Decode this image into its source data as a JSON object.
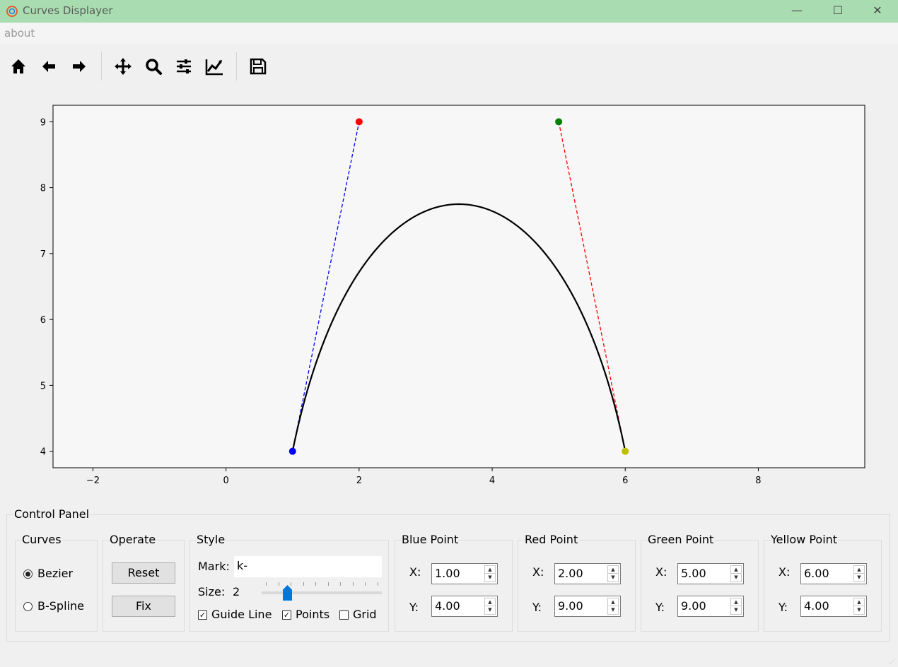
{
  "window": {
    "title": "Curves Displayer"
  },
  "menu": {
    "about": "about"
  },
  "toolbar": {
    "icons": [
      "home-icon",
      "back-arrow-icon",
      "forward-arrow-icon",
      "pan-icon",
      "zoom-icon",
      "configure-subplots-icon",
      "edit-axis-icon",
      "save-icon"
    ]
  },
  "chart_data": {
    "type": "line",
    "title": "",
    "xlabel": "",
    "ylabel": "",
    "xlim": [
      -2.6,
      9.6
    ],
    "ylim": [
      3.75,
      9.25
    ],
    "x_ticks": [
      "−2",
      "0",
      "2",
      "4",
      "6",
      "8"
    ],
    "y_ticks": [
      "4",
      "5",
      "6",
      "7",
      "8",
      "9"
    ],
    "grid": false,
    "control_points": [
      {
        "color": "#0000ff",
        "x": 1,
        "y": 4
      },
      {
        "color": "#ff0000",
        "x": 2,
        "y": 9
      },
      {
        "color": "#008000",
        "x": 5,
        "y": 9
      },
      {
        "color": "#bfbf00",
        "x": 6,
        "y": 4
      }
    ],
    "guide_lines": [
      {
        "color": "#0000ff",
        "from": [
          1,
          4
        ],
        "to": [
          2,
          9
        ]
      },
      {
        "color": "#ff0000",
        "from": [
          5,
          9
        ],
        "to": [
          6,
          4
        ]
      }
    ],
    "curve": {
      "kind": "cubic-bezier",
      "color": "#000000"
    }
  },
  "panel": {
    "title": "Control Panel",
    "curves": {
      "title": "Curves",
      "options": [
        "Bezier",
        "B-Spline"
      ],
      "selected": "Bezier"
    },
    "operate": {
      "title": "Operate",
      "reset": "Reset",
      "fix": "Fix"
    },
    "style": {
      "title": "Style",
      "mark_label": "Mark:",
      "mark_value": "k-",
      "size_label": "Size:",
      "size_value": "2",
      "guide_line": "Guide Line",
      "points": "Points",
      "grid": "Grid",
      "guide_line_checked": true,
      "points_checked": true,
      "grid_checked": false
    },
    "points": [
      {
        "title": "Blue Point",
        "x_label": "X:",
        "y_label": "Y:",
        "x": "1.00",
        "y": "4.00"
      },
      {
        "title": "Red Point",
        "x_label": "X:",
        "y_label": "Y:",
        "x": "2.00",
        "y": "9.00"
      },
      {
        "title": "Green Point",
        "x_label": "X:",
        "y_label": "Y:",
        "x": "5.00",
        "y": "9.00"
      },
      {
        "title": "Yellow Point",
        "x_label": "X:",
        "y_label": "Y:",
        "x": "6.00",
        "y": "4.00"
      }
    ]
  }
}
